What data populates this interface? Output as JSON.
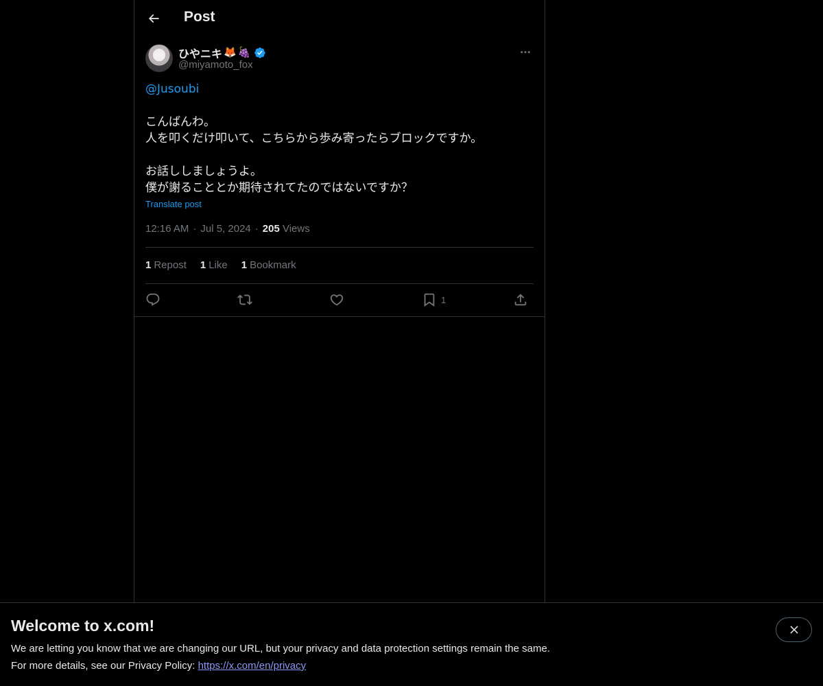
{
  "header": {
    "title": "Post"
  },
  "author": {
    "display_name": "ひやニキ",
    "emoji_1": "🦊",
    "emoji_2": "🍇",
    "handle": "@miyamoto_fox"
  },
  "post": {
    "mention": "@Jusoubi",
    "line_1": "こんばんわ。",
    "line_2": "人を叩くだけ叩いて、こちらから歩み寄ったらブロックですか。",
    "line_3": "お話ししましょうよ。",
    "line_4": "僕が謝ることとか期待されてたのではないですか？",
    "translate_label": "Translate post"
  },
  "meta": {
    "time": "12:16 AM",
    "date": "Jul 5, 2024",
    "views_count": "205",
    "views_label": "Views"
  },
  "stats": {
    "reposts_count": "1",
    "reposts_label": "Repost",
    "likes_count": "1",
    "likes_label": "Like",
    "bookmarks_count": "1",
    "bookmarks_label": "Bookmark"
  },
  "actions": {
    "reply_icon": "reply-icon",
    "repost_icon": "repost-icon",
    "like_icon": "heart-icon",
    "bookmark_icon": "bookmark-icon",
    "bookmark_count": "1",
    "share_icon": "share-icon"
  },
  "banner": {
    "title": "Welcome to x.com!",
    "text_1": "We are letting you know that we are changing our URL, but your privacy and data protection settings remain the same.",
    "text_2_prefix": "For more details, see our Privacy Policy: ",
    "link": "https://x.com/en/privacy"
  },
  "colors": {
    "background": "#000000",
    "text": "#e7e9ea",
    "secondary_text": "#71767b",
    "accent": "#1d9bf0",
    "border": "#2f3336"
  }
}
